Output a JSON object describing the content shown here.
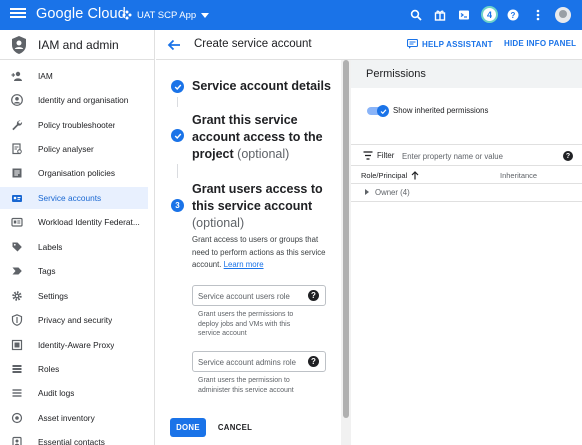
{
  "topbar": {
    "logo": "Google Cloud",
    "project": "UAT SCP App",
    "notification_count": "4",
    "icons": [
      "search-icon",
      "gift-icon",
      "terminal-icon",
      "help-icon",
      "more-vert-icon"
    ]
  },
  "sidebar": {
    "title": "IAM and admin",
    "items": [
      {
        "label": "IAM",
        "icon": "person-add-icon"
      },
      {
        "label": "Identity and organisation",
        "icon": "account-circle-icon"
      },
      {
        "label": "Policy troubleshooter",
        "icon": "wrench-icon"
      },
      {
        "label": "Policy analyser",
        "icon": "policy-doc-icon"
      },
      {
        "label": "Organisation policies",
        "icon": "list-doc-icon"
      },
      {
        "label": "Service accounts",
        "icon": "service-account-icon"
      },
      {
        "label": "Workload Identity Federat...",
        "icon": "id-card-icon"
      },
      {
        "label": "Labels",
        "icon": "label-icon"
      },
      {
        "label": "Tags",
        "icon": "tag-chevron-icon"
      },
      {
        "label": "Settings",
        "icon": "gear-icon"
      },
      {
        "label": "Privacy and security",
        "icon": "shield-icon"
      },
      {
        "label": "Identity-Aware Proxy",
        "icon": "proxy-icon"
      },
      {
        "label": "Roles",
        "icon": "roles-icon"
      },
      {
        "label": "Audit logs",
        "icon": "audit-list-icon"
      },
      {
        "label": "Asset inventory",
        "icon": "asset-icon"
      },
      {
        "label": "Essential contacts",
        "icon": "contacts-icon"
      }
    ],
    "active_index": 5
  },
  "header": {
    "title": "Create service account",
    "help_assistant": "HELP ASSISTANT",
    "hide_info_panel": "HIDE INFO PANEL"
  },
  "form": {
    "step1_title": "Service account details",
    "step2_title": "Grant this service account access to the project",
    "step2_optional": "(optional)",
    "step3_number": "3",
    "step3_title": "Grant users access to this service account",
    "step3_optional": "(optional)",
    "step3_desc": "Grant access to users or groups that need to perform actions as this service account.",
    "learn_more": "Learn more",
    "users_role_placeholder": "Service account users role",
    "users_role_hint": "Grant users the permissions to deploy jobs and VMs with this service account",
    "admins_role_placeholder": "Service account admins role",
    "admins_role_hint": "Grant users the permission to administer this service account",
    "done": "DONE",
    "cancel": "CANCEL"
  },
  "permissions": {
    "title": "Permissions",
    "show_inherited": "Show inherited permissions",
    "show_inherited_on": true,
    "filter_label": "Filter",
    "filter_placeholder": "Enter property name or value",
    "col_role": "Role/Principal",
    "col_inheritance": "Inheritance",
    "owner_row": "Owner (4)"
  },
  "colors": {
    "brand": "#1a73e8",
    "active_bg": "#e8f0fe",
    "panel_header": "#f1f3f4"
  }
}
